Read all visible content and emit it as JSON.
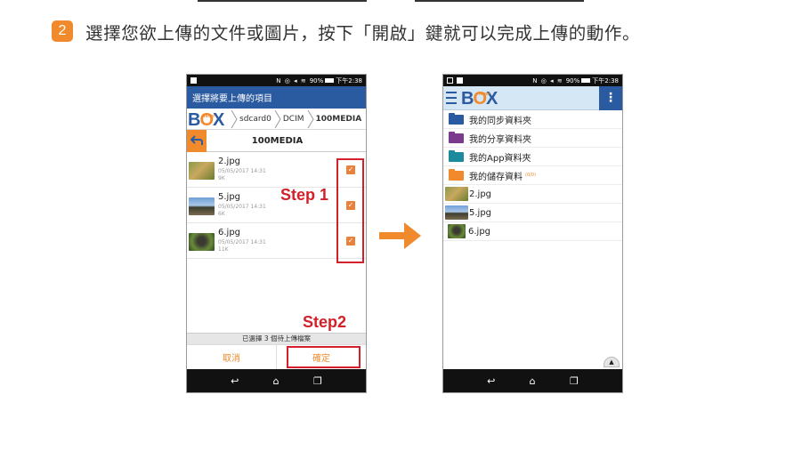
{
  "header": {
    "step_number": "2",
    "instruction": "選擇您欲上傳的文件或圖片，按下「開啟」鍵就可以完成上傳的動作。"
  },
  "annotations": {
    "step1": "Step 1",
    "step2": "Step2",
    "highlight_color": "#d3202a"
  },
  "left_phone": {
    "status": {
      "signal": "90%",
      "time": "下午2:38"
    },
    "title": "選擇將要上傳的項目",
    "breadcrumbs": [
      "sdcard0",
      "DCIM",
      "100MEDIA"
    ],
    "folder_title": "100MEDIA",
    "files": [
      {
        "name": "2.jpg",
        "date": "05/05/2017 14:31",
        "size": "9K",
        "checked": true
      },
      {
        "name": "5.jpg",
        "date": "05/05/2017 14:31",
        "size": "6K",
        "checked": true
      },
      {
        "name": "6.jpg",
        "date": "05/05/2017 14:31",
        "size": "11K",
        "checked": true
      }
    ],
    "selection_status": "已選擇 3 個待上傳檔案",
    "cancel_label": "取消",
    "confirm_label": "確定"
  },
  "right_phone": {
    "status": {
      "signal": "90%",
      "time": "下午2:38"
    },
    "folders": [
      {
        "label": "我的同步資料夾",
        "icon": "folder-sync-icon"
      },
      {
        "label": "我的分享資料夾",
        "icon": "folder-share-icon"
      },
      {
        "label": "我的App資料夾",
        "icon": "folder-app-icon"
      },
      {
        "label": "我的儲存資料",
        "icon": "storage-icon",
        "quota": "(0/0)"
      }
    ],
    "files": [
      {
        "name": "2.jpg"
      },
      {
        "name": "5.jpg"
      },
      {
        "name": "6.jpg"
      }
    ]
  },
  "brand": {
    "logo_text": "BOX",
    "logo_tag": "hinet",
    "primary": "#2a5aa0",
    "accent": "#f08a2c"
  }
}
